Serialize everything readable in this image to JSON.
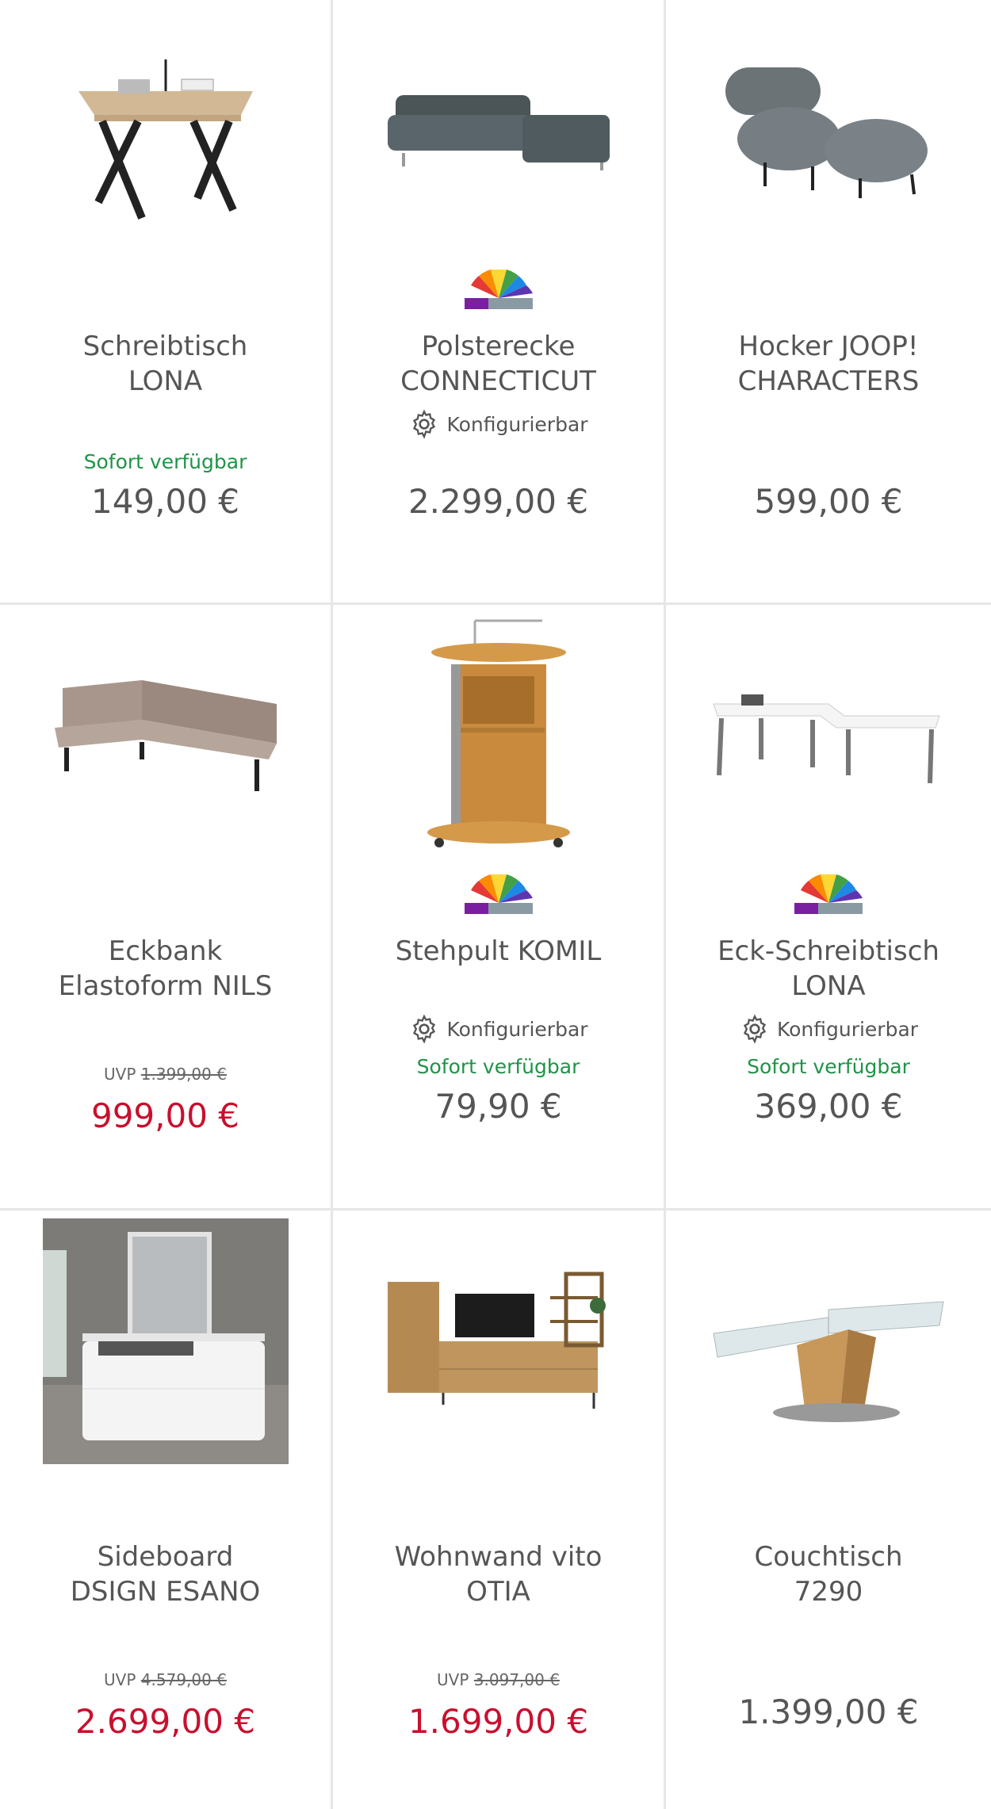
{
  "products": [
    {
      "title": "Schreibtisch LONA",
      "title_lines": [
        "Schreibtisch",
        "LONA"
      ],
      "configurable": "",
      "availability": "Sofort verfügbar",
      "uvp_label": "",
      "uvp": "",
      "price": "149,00 €",
      "sale": false
    },
    {
      "title": "Polsterecke CONNECTICUT",
      "title_lines": [
        "Polsterecke",
        "CONNECTICUT"
      ],
      "configurable": "Konfigurierbar",
      "availability": "",
      "uvp_label": "",
      "uvp": "",
      "price": "2.299,00 €",
      "sale": false
    },
    {
      "title": "Hocker JOOP! CHARACTERS",
      "title_lines": [
        "Hocker JOOP!",
        "CHARACTERS"
      ],
      "configurable": "",
      "availability": "",
      "uvp_label": "",
      "uvp": "",
      "price": "599,00 €",
      "sale": false
    },
    {
      "title": "Eckbank Elastoform NILS",
      "title_lines": [
        "Eckbank",
        "Elastoform NILS"
      ],
      "configurable": "",
      "availability": "",
      "uvp_label": "UVP",
      "uvp": "1.399,00 €",
      "price": "999,00 €",
      "sale": true
    },
    {
      "title": "Stehpult KOMIL",
      "title_lines": [
        "Stehpult KOMIL",
        ""
      ],
      "configurable": "Konfigurierbar",
      "availability": "Sofort verfügbar",
      "uvp_label": "",
      "uvp": "",
      "price": "79,90 €",
      "sale": false
    },
    {
      "title": "Eck-Schreibtisch LONA",
      "title_lines": [
        "Eck-Schreibtisch",
        "LONA"
      ],
      "configurable": "Konfigurierbar",
      "availability": "Sofort verfügbar",
      "uvp_label": "",
      "uvp": "",
      "price": "369,00 €",
      "sale": false
    },
    {
      "title": "Sideboard DSIGN ESANO",
      "title_lines": [
        "Sideboard",
        "DSIGN ESANO"
      ],
      "configurable": "",
      "availability": "",
      "uvp_label": "UVP",
      "uvp": "4.579,00 €",
      "price": "2.699,00 €",
      "sale": true
    },
    {
      "title": "Wohnwand vito OTIA",
      "title_lines": [
        "Wohnwand vito",
        "OTIA"
      ],
      "configurable": "",
      "availability": "",
      "uvp_label": "UVP",
      "uvp": "3.097,00 €",
      "price": "1.699,00 €",
      "sale": true
    },
    {
      "title": "Couchtisch 7290",
      "title_lines": [
        "Couchtisch",
        "7290"
      ],
      "configurable": "",
      "availability": "",
      "uvp_label": "",
      "uvp": "",
      "price": "1.399,00 €",
      "sale": false
    }
  ],
  "icons": {
    "gear": "gear-icon",
    "brand_logo": "rainbow-brand-logo"
  },
  "colors": {
    "available": "#1e9447",
    "sale_price": "#c8102e",
    "text": "#555555",
    "divider": "#e6e6e6"
  }
}
